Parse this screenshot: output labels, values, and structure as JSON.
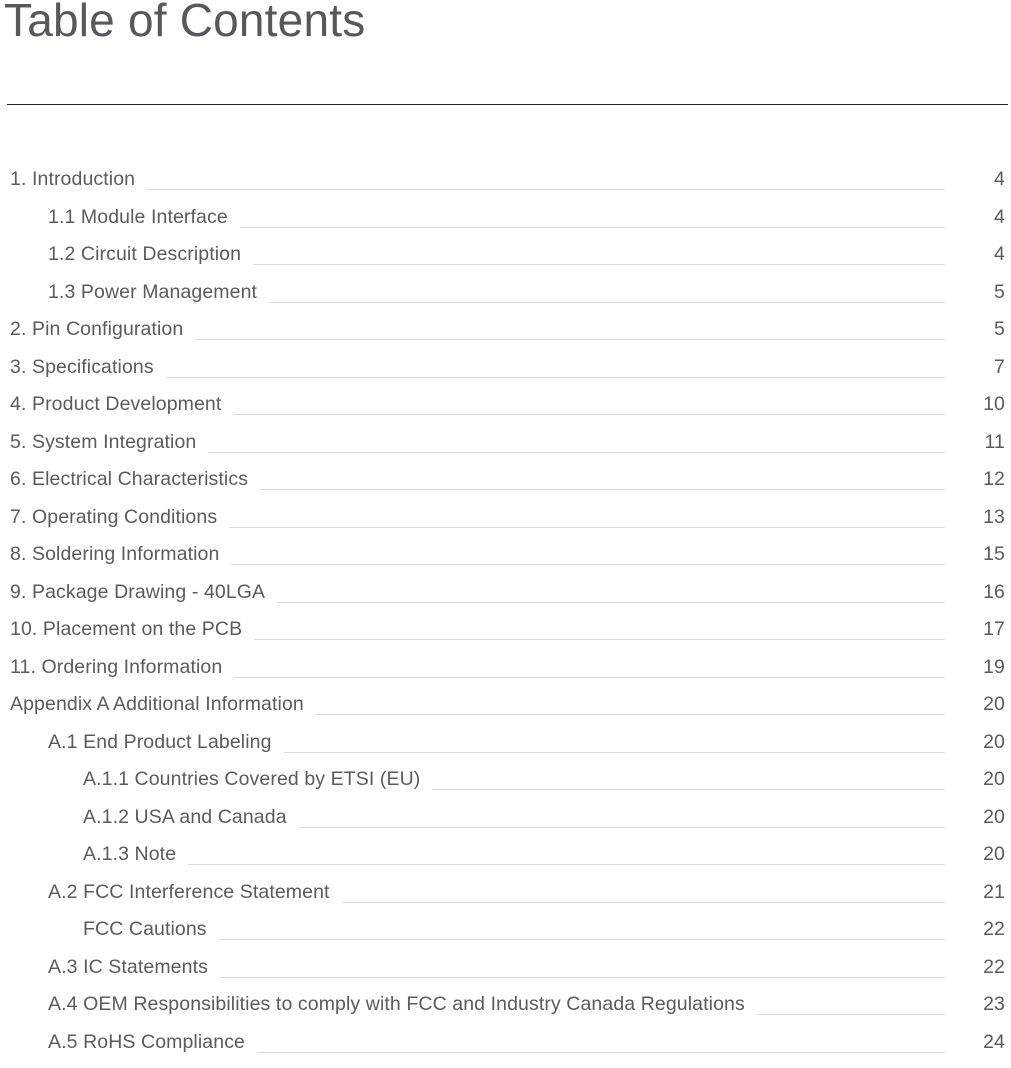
{
  "document": {
    "title": "Table of Contents",
    "colors": {
      "text": "#5b5b5f",
      "title": "#58585c",
      "rule": "#231f20",
      "leader": "#dcdcdc",
      "background": "#ffffff"
    }
  },
  "toc": {
    "entries": [
      {
        "label": "1. Introduction",
        "page": "4",
        "level": 0
      },
      {
        "label": "1.1 Module Interface",
        "page": "4",
        "level": 1
      },
      {
        "label": "1.2 Circuit Description",
        "page": "4",
        "level": 1
      },
      {
        "label": "1.3 Power Management",
        "page": "5",
        "level": 1
      },
      {
        "label": "2. Pin Configuration",
        "page": "5",
        "level": 0
      },
      {
        "label": "3. Specifications",
        "page": "7",
        "level": 0
      },
      {
        "label": "4. Product Development",
        "page": "10",
        "level": 0
      },
      {
        "label": "5. System Integration",
        "page": "11",
        "level": 0
      },
      {
        "label": "6. Electrical Characteristics",
        "page": "12",
        "level": 0
      },
      {
        "label": "7. Operating Conditions",
        "page": "13",
        "level": 0
      },
      {
        "label": "8. Soldering Information",
        "page": "15",
        "level": 0
      },
      {
        "label": "9. Package Drawing - 40LGA",
        "page": "16",
        "level": 0
      },
      {
        "label": "10. Placement on the PCB",
        "page": "17",
        "level": 0
      },
      {
        "label": "11. Ordering Information",
        "page": "19",
        "level": 0
      },
      {
        "label": "Appendix A Additional Information",
        "page": "20",
        "level": 0
      },
      {
        "label": "A.1 End Product Labeling",
        "page": "20",
        "level": 1
      },
      {
        "label": "A.1.1 Countries Covered by ETSI (EU)",
        "page": "20",
        "level": 2
      },
      {
        "label": "A.1.2 USA and Canada",
        "page": "20",
        "level": 2
      },
      {
        "label": "A.1.3 Note",
        "page": "20",
        "level": 2
      },
      {
        "label": "A.2 FCC Interference Statement",
        "page": "21",
        "level": 1
      },
      {
        "label": "FCC Cautions",
        "page": "22",
        "level": 2
      },
      {
        "label": "A.3 IC Statements",
        "page": "22",
        "level": 1
      },
      {
        "label": "A.4 OEM Responsibilities to comply with FCC and Industry Canada Regulations",
        "page": "23",
        "level": 1
      },
      {
        "label": "A.5 RoHS Compliance",
        "page": "24",
        "level": 1
      }
    ]
  }
}
